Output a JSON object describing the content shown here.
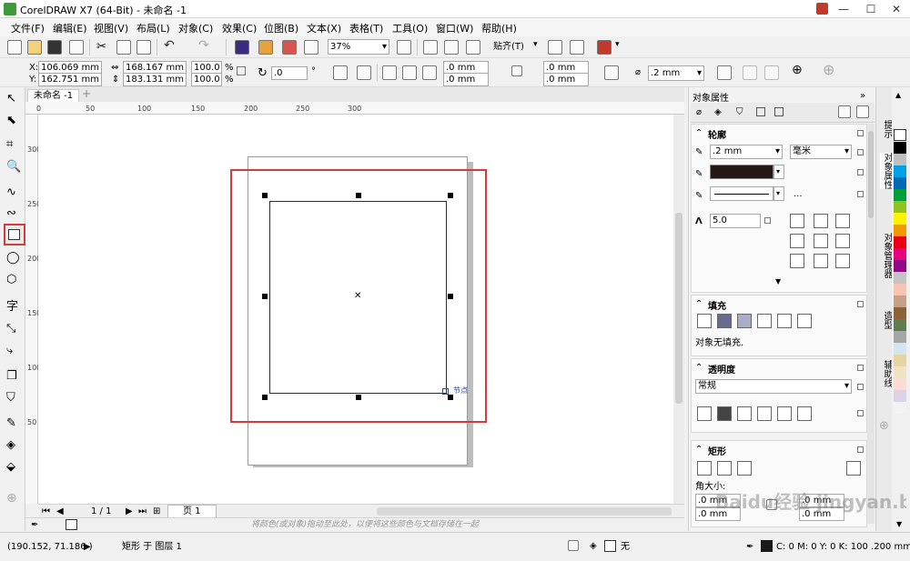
{
  "title_bar": {
    "title": "CorelDRAW X7 (64-Bit) - 未命名 -1",
    "minimize": "—",
    "maximize": "☐",
    "close": "✕"
  },
  "menu": [
    "文件(F)",
    "编辑(E)",
    "视图(V)",
    "布局(L)",
    "对象(C)",
    "效果(C)",
    "位图(B)",
    "文本(X)",
    "表格(T)",
    "工具(O)",
    "窗口(W)",
    "帮助(H)"
  ],
  "toolbar": {
    "zoom": "37%",
    "snap": "贴齐(T)"
  },
  "property_bar": {
    "x_label": "X:",
    "x": "106.069 mm",
    "y_label": "Y:",
    "y": "162.751 mm",
    "w": "168.167 mm",
    "h": "183.131 mm",
    "scale_w": "100.0",
    "scale_h": "100.0",
    "pct": "%",
    "rotate": ".0",
    "degree": "°",
    "corner_a": ".0 mm",
    "corner_b": ".0 mm",
    "corner_c": ".0 mm",
    "corner_d": ".0 mm",
    "outline": ".2 mm"
  },
  "doc_tab": "未命名 -1",
  "doc_tab_add": "+",
  "rulers": {
    "h": [
      "0",
      "50",
      "100",
      "150",
      "200",
      "250",
      "300"
    ],
    "v": [
      "300",
      "250",
      "200",
      "150",
      "100",
      "50"
    ]
  },
  "canvas": {
    "node_label": "节点"
  },
  "page_nav": {
    "current": "1 / 1",
    "page_tab": "页 1"
  },
  "status_hint": "将颜色(或对象)拖动至此处，以便将这些颜色与文档存储在一起",
  "status_bar": {
    "coords": "(190.152, 71.186 )",
    "object": "矩形 于 图层 1",
    "fill": "无",
    "color_info": "C: 0 M: 0 Y: 0 K: 100  .200 mm"
  },
  "docker": {
    "title": "对象属性",
    "outline_section": "轮廓",
    "outline_width": ".2 mm",
    "outline_unit": "毫米",
    "more": "...",
    "miter": "5.0",
    "fill_section": "填充",
    "fill_note": "对象无填充.",
    "transparency_section": "透明度",
    "transparency_mode": "常规",
    "rect_section": "矩形",
    "corner_size": "角大小:",
    "corner_a": ".0 mm",
    "corner_b": ".0 mm",
    "corner_c": ".0 mm",
    "corner_d": ".0 mm"
  },
  "side_tabs": [
    "提示",
    "对象属性",
    "对象管理器",
    "造型",
    "辅助线"
  ],
  "palette": [
    "#ffffff",
    "#000000",
    "#bfbfbf",
    "#00a0e9",
    "#0068b7",
    "#009e3a",
    "#8fc31f",
    "#fff100",
    "#f39800",
    "#e60012",
    "#e4007f",
    "#920783",
    "#c3c3c3",
    "#f6c4b0",
    "#c7a08a",
    "#8c6239",
    "#5e7c4e",
    "#a6a6a6",
    "#d1e6f0",
    "#e8d3a5",
    "#efe3c4",
    "#fadcd2",
    "#ddd1e6",
    "#f3f3f3"
  ],
  "colors": {
    "highlight": "#d63b3b",
    "selection": "#2b2b2b"
  },
  "watermark": "Baidu经验 jingyan.baidu.com"
}
